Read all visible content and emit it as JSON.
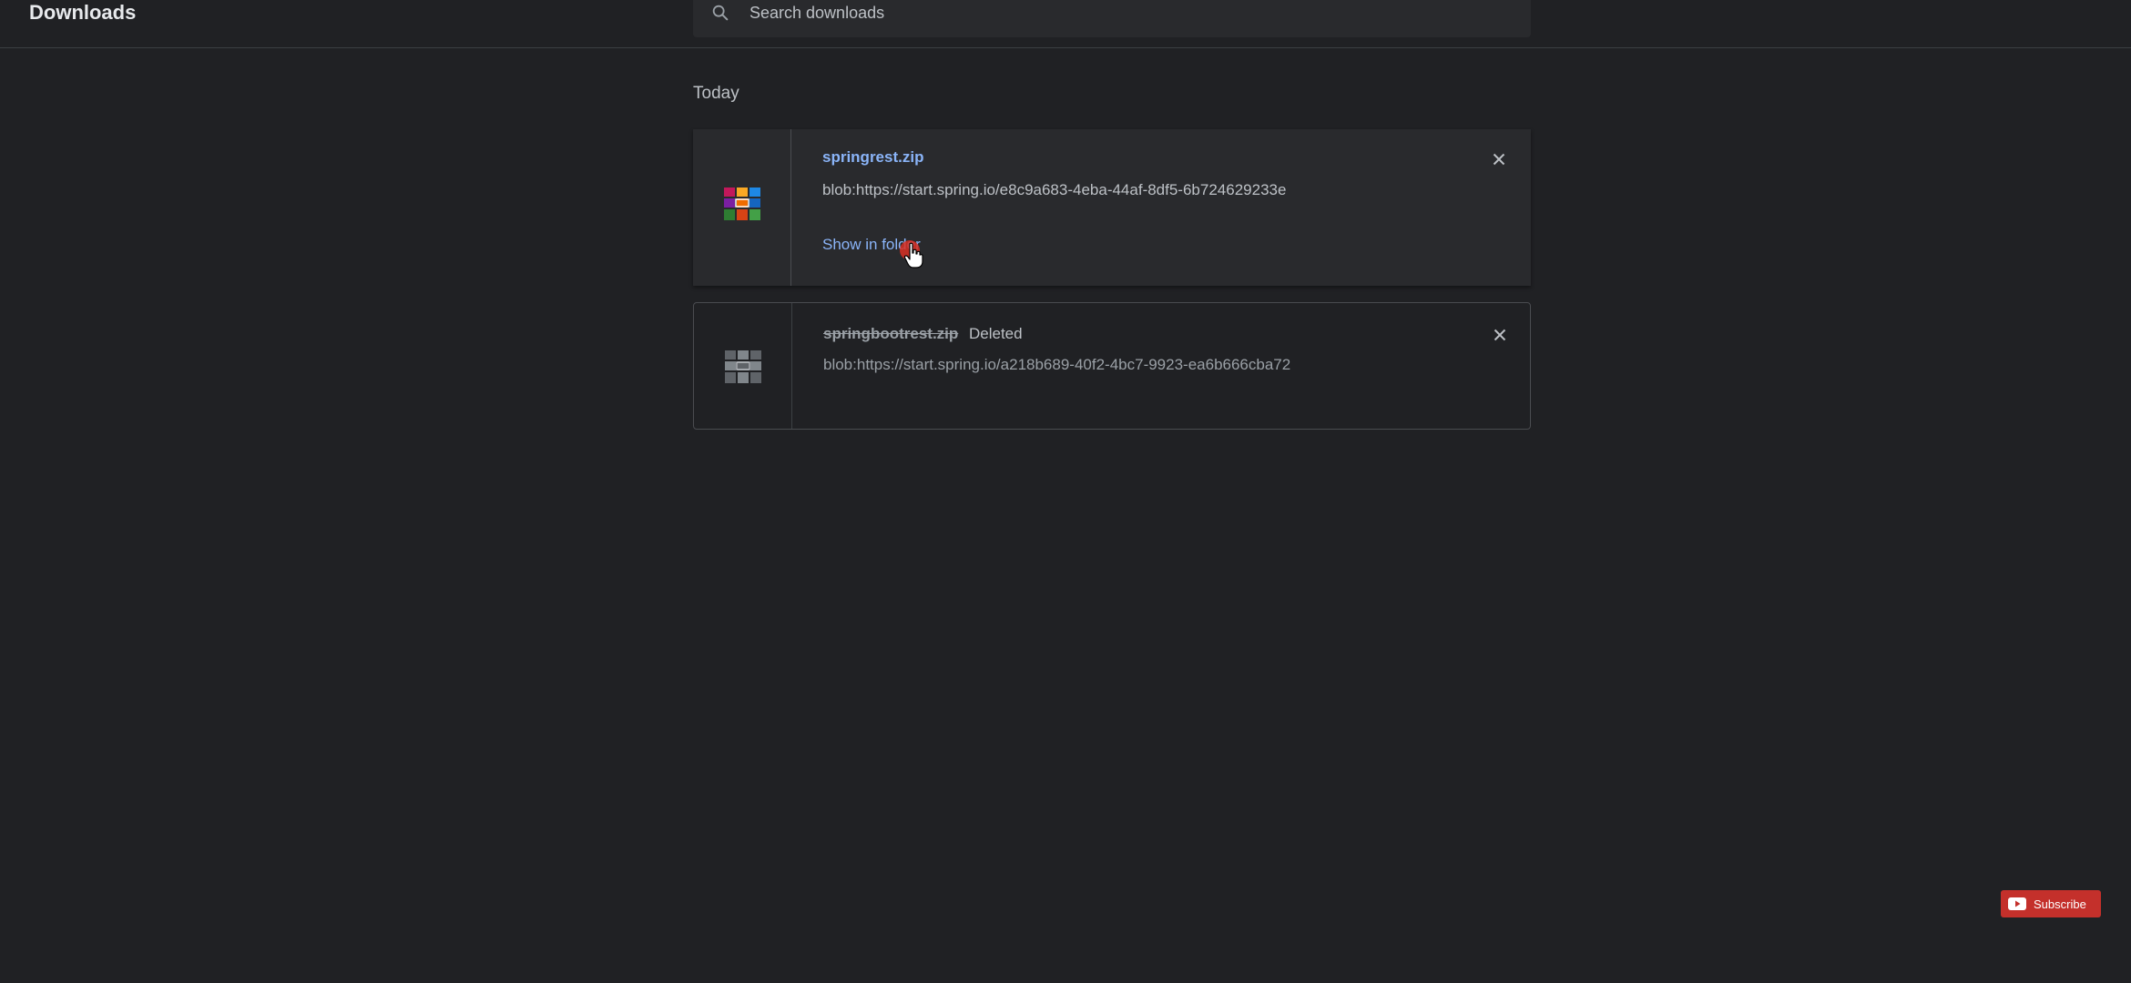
{
  "header": {
    "title": "Downloads",
    "search": {
      "placeholder": "Search downloads",
      "value": "",
      "icon": "search-icon"
    }
  },
  "section": {
    "label": "Today"
  },
  "downloads": [
    {
      "file_name": "springrest.zip",
      "url": "blob:https://start.spring.io/e8c9a683-4eba-44af-8df5-6b724629233e",
      "action_label": "Show in folder",
      "icon": "archive-icon",
      "state": "complete"
    },
    {
      "file_name": "springbootrest.zip",
      "status": "Deleted",
      "url": "blob:https://start.spring.io/a218b689-40f2-4bc7-9923-ea6b666cba72",
      "icon": "archive-icon",
      "state": "deleted"
    }
  ],
  "overlay": {
    "subscribe_label": "Subscribe"
  },
  "colors": {
    "background": "#202124",
    "link": "#8ab4f8",
    "subscribe": "#c4302b"
  }
}
